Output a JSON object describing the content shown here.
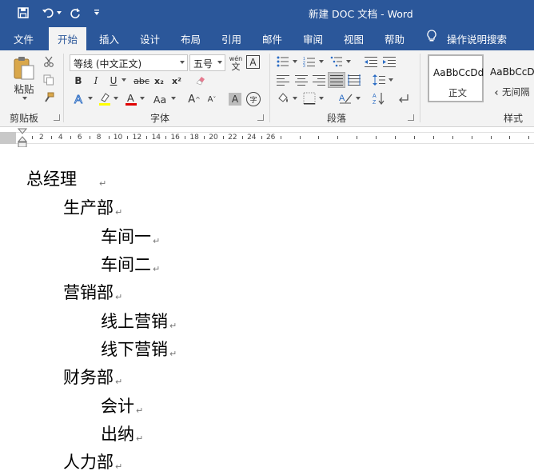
{
  "titlebar": {
    "title": "新建 DOC 文档 - Word"
  },
  "tabs": [
    {
      "label": "文件"
    },
    {
      "label": "开始"
    },
    {
      "label": "插入"
    },
    {
      "label": "设计"
    },
    {
      "label": "布局"
    },
    {
      "label": "引用"
    },
    {
      "label": "邮件"
    },
    {
      "label": "审阅"
    },
    {
      "label": "视图"
    },
    {
      "label": "帮助"
    }
  ],
  "tell_me": "操作说明搜索",
  "ribbon": {
    "clipboard": {
      "paste_label": "粘贴",
      "group_label": "剪贴板"
    },
    "font": {
      "font_name": "等线 (中文正文)",
      "font_size": "五号",
      "phonetic_top": "wén",
      "phonetic_bottom": "文",
      "char_border": "A",
      "bold": "B",
      "italic": "I",
      "underline": "U",
      "strike": "abc",
      "subscript": "x₂",
      "superscript": "x²",
      "change_case": "Aa",
      "grow": "A",
      "shrink": "A",
      "char_shading": "A",
      "enclose": "字",
      "group_label": "字体"
    },
    "paragraph": {
      "group_label": "段落"
    },
    "styles": {
      "items": [
        {
          "sample": "AaBbCcDd",
          "name": "正文"
        },
        {
          "sample": "AaBbCcDd",
          "name": "无间隔"
        }
      ],
      "group_label": "样式"
    }
  },
  "ruler": {
    "labels": [
      "2",
      "4",
      "6",
      "8",
      "10",
      "12",
      "14",
      "16",
      "18",
      "20",
      "22",
      "24",
      "26"
    ]
  },
  "document": {
    "lines": [
      {
        "text": "总经理",
        "level": 0
      },
      {
        "text": "生产部",
        "level": 1
      },
      {
        "text": "车间一",
        "level": 2
      },
      {
        "text": "车间二",
        "level": 2
      },
      {
        "text": "营销部",
        "level": 1
      },
      {
        "text": "线上营销",
        "level": 2
      },
      {
        "text": "线下营销",
        "level": 2
      },
      {
        "text": "财务部",
        "level": 1
      },
      {
        "text": "会计",
        "level": 2
      },
      {
        "text": "出纳",
        "level": 2
      },
      {
        "text": "人力部",
        "level": 1
      }
    ],
    "paragraph_mark": "↵"
  }
}
